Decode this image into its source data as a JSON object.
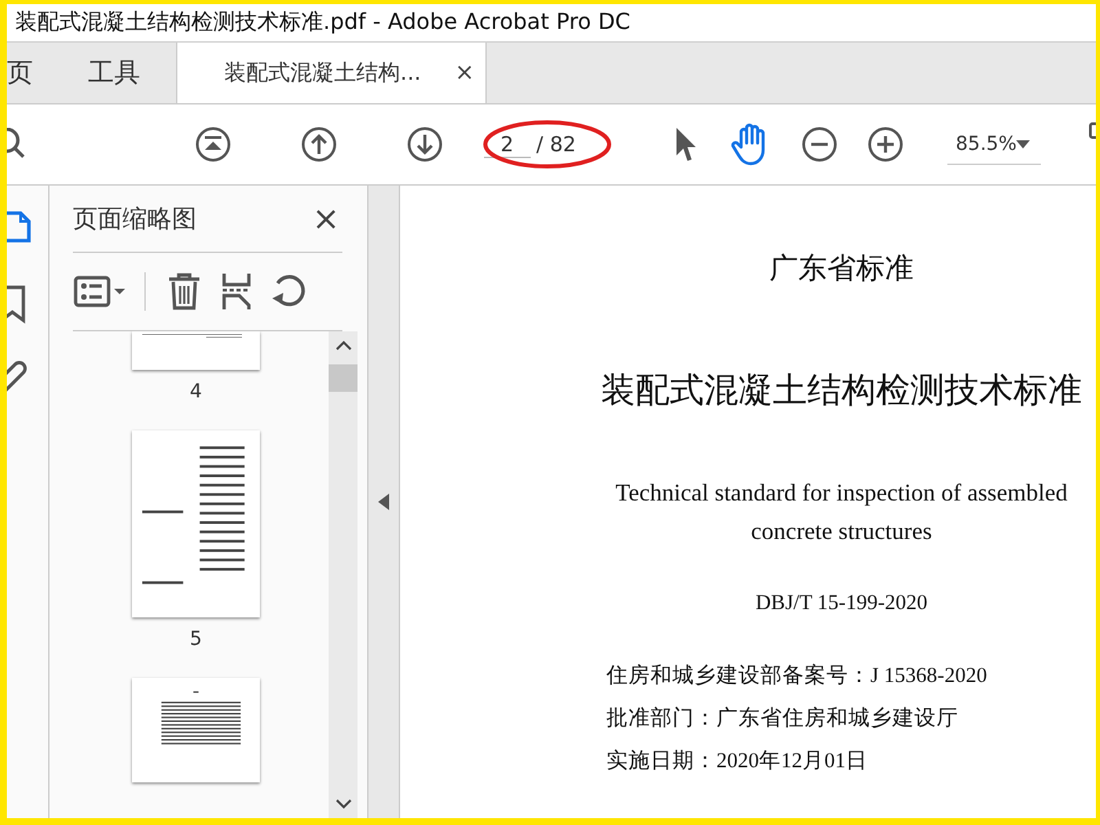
{
  "window": {
    "title": "装配式混凝土结构检测技术标准.pdf - Adobe Acrobat Pro DC"
  },
  "tabs": [
    {
      "label": "页",
      "kind": "nav",
      "selected": false
    },
    {
      "label": "工具",
      "kind": "nav",
      "selected": false
    },
    {
      "label": "装配式混凝土结构...",
      "kind": "document",
      "selected": true,
      "close": "×"
    }
  ],
  "toolbar": {
    "page_number": "2",
    "page_total": "/ 82",
    "zoom": "85.5%",
    "hand_tool_selected": true
  },
  "rail": [
    {
      "kind": "thumbnails",
      "selected": true
    },
    {
      "kind": "bookmark",
      "selected": false
    },
    {
      "kind": "attachment",
      "selected": false
    }
  ],
  "panel": {
    "title": "页面缩略图",
    "close": "×",
    "thumbnails": [
      {
        "kind": "partial-top",
        "label": "4"
      },
      {
        "kind": "names",
        "label": "5"
      },
      {
        "kind": "text"
      }
    ]
  },
  "document": {
    "lines": [
      {
        "kind": "org",
        "text": "广东省标准"
      },
      {
        "kind": "title",
        "text": "装配式混凝土结构检测技术标准"
      },
      {
        "kind": "english",
        "text": "Technical standard for inspection of assembled concrete structures"
      },
      {
        "kind": "code",
        "text": "DBJ/T 15-199-2020"
      },
      {
        "kind": "meta",
        "text": "住房和城乡建设部备案号：J 15368-2020"
      },
      {
        "kind": "meta",
        "text": "批准部门：广东省住房和城乡建设厅"
      },
      {
        "kind": "meta",
        "text": "实施日期：2020年12月01日"
      }
    ]
  }
}
